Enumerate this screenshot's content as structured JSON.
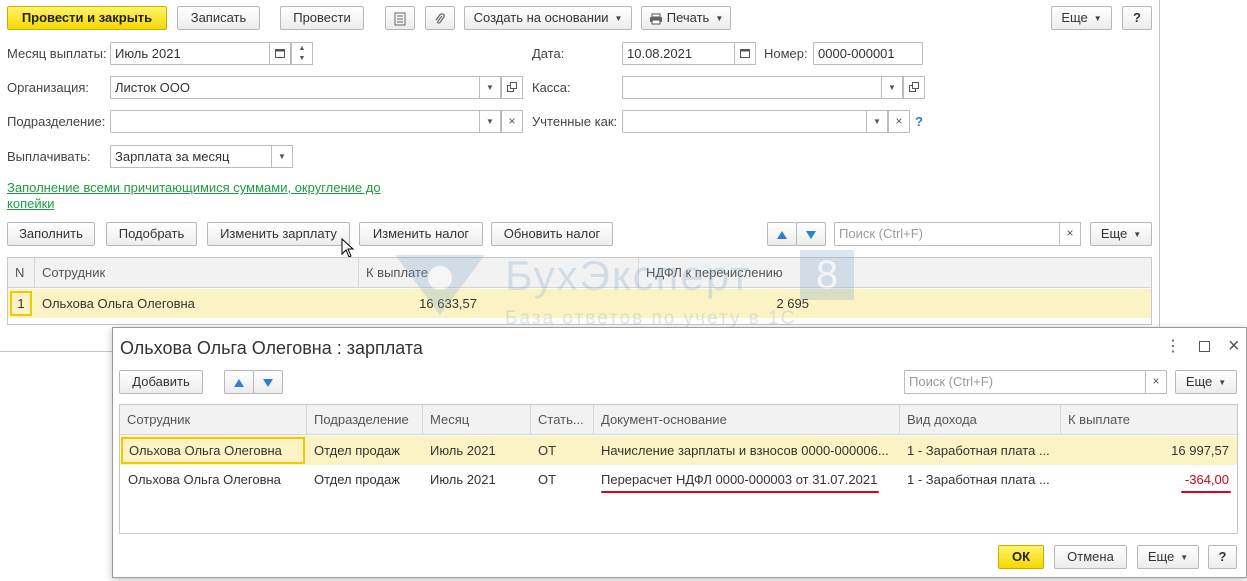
{
  "toolbar": {
    "post_close": "Провести и закрыть",
    "save": "Записать",
    "post": "Провести",
    "create_based": "Создать на основании",
    "print": "Печать",
    "more": "Еще",
    "help": "?"
  },
  "form": {
    "month_label": "Месяц выплаты:",
    "month_value": "Июль 2021",
    "date_label": "Дата:",
    "date_value": "10.08.2021",
    "number_label": "Номер:",
    "number_value": "0000-000001",
    "org_label": "Организация:",
    "org_value": "Листок ООО",
    "cash_label": "Касса:",
    "cash_value": "",
    "dept_label": "Подразделение:",
    "dept_value": "",
    "counted_label": "Учтенные как:",
    "counted_value": "",
    "counted_help": "?",
    "pay_label": "Выплачивать:",
    "pay_value": "Зарплата за месяц",
    "fill_link": "Заполнение всеми причитающимися суммами, округление до копейки"
  },
  "table_toolbar": {
    "fill": "Заполнить",
    "pick": "Подобрать",
    "change_salary": "Изменить зарплату",
    "change_tax": "Изменить налог",
    "update_tax": "Обновить налог",
    "search_placeholder": "Поиск (Ctrl+F)",
    "more": "Еще"
  },
  "main_table": {
    "columns": [
      "N",
      "Сотрудник",
      "К выплате",
      "НДФЛ к перечислению"
    ],
    "rows": [
      {
        "n": "1",
        "employee": "Ольхова Ольга Олеговна",
        "to_pay": "16 633,57",
        "ndfl": "2 695"
      }
    ]
  },
  "watermark": {
    "title": "БухЭксперт",
    "num": "8",
    "subtitle": "База ответов по учету в 1С"
  },
  "dialog": {
    "title": "Ольхова Ольга Олеговна : зарплата",
    "add": "Добавить",
    "search_placeholder": "Поиск (Ctrl+F)",
    "more": "Еще",
    "columns": [
      "Сотрудник",
      "Подразделение",
      "Месяц",
      "Стать...",
      "Документ-основание",
      "Вид дохода",
      "К выплате"
    ],
    "rows": [
      {
        "employee": "Ольхова Ольга Олеговна",
        "dept": "Отдел продаж",
        "month": "Июль 2021",
        "article": "ОТ",
        "doc": "Начисление зарплаты и взносов 0000-000006...",
        "income": "1 - Заработная плата ...",
        "amount": "16 997,57"
      },
      {
        "employee": "Ольхова Ольга Олеговна",
        "dept": "Отдел продаж",
        "month": "Июль 2021",
        "article": "ОТ",
        "doc": "Перерасчет НДФЛ 0000-000003 от 31.07.2021",
        "income": "1 - Заработная плата ...",
        "amount": "-364,00"
      }
    ],
    "ok": "ОК",
    "cancel": "Отмена",
    "help": "?"
  },
  "colors": {
    "accent_yellow": "#f4d800",
    "row_highlight": "#fcf3c4",
    "link_green": "#1b9e3e",
    "negative_red": "#d0001b",
    "underline_red": "#e0001b"
  }
}
